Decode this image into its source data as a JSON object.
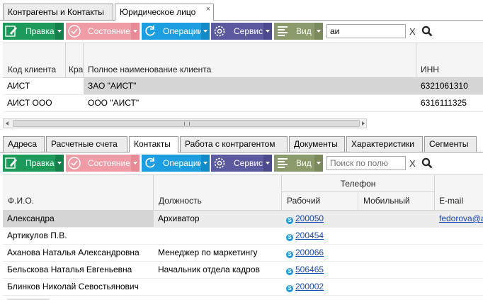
{
  "top_tabs": [
    {
      "label": "Контрагенты и Контакты"
    },
    {
      "label": "Юридическое лицо",
      "close": "×"
    }
  ],
  "toolbar1": {
    "edit": "Правка",
    "state": "Состояние",
    "ops": "Операции",
    "service": "Сервис",
    "view": "Вид",
    "search_value": "аи",
    "clear": "X"
  },
  "clients_table": {
    "headers": {
      "code": "Код клиента",
      "short": "Кра",
      "full": "Полное наименование клиента",
      "inn": "ИНН"
    },
    "rows": [
      {
        "code": "АИСТ",
        "full": "ЗАО \"АИСТ\"",
        "inn": "6321061310"
      },
      {
        "code": "АИСТ ООО",
        "full": "ООО \"АИСТ\"",
        "inn": "6316111325"
      }
    ]
  },
  "detail_tabs": [
    "Адреса",
    "Расчетные счета",
    "Контакты",
    "Работа с контрагентом",
    "Документы",
    "Характеристики",
    "Сегменты"
  ],
  "toolbar2": {
    "edit": "Правка",
    "state": "Состояние",
    "ops": "Операции",
    "service": "Сервис",
    "view": "Вид",
    "search_placeholder": "Поиск по полю",
    "clear": "X"
  },
  "contacts_table": {
    "headers": {
      "fio": "Ф.И.О.",
      "position": "Должность",
      "phone": "Телефон",
      "work": "Рабочий",
      "mobile": "Мобильный",
      "email": "E-mail"
    },
    "rows": [
      {
        "fio": "Александра",
        "position": "Архиватор",
        "work": "200050",
        "email": "fedorova@a"
      },
      {
        "fio": "Артикулов П.В.",
        "position": "",
        "work": "200454",
        "email": ""
      },
      {
        "fio": "Аханова Наталья Александровна",
        "position": "Менеджер по маркетингу",
        "work": "200066",
        "email": ""
      },
      {
        "fio": "Бельскова Наталья Евгеньевна",
        "position": "Начальник отдела кадров",
        "work": "506465",
        "email": ""
      },
      {
        "fio": "Блинков Николай Севостьянович",
        "position": "",
        "work": "200002",
        "email": ""
      }
    ]
  },
  "colors": {
    "green": "#1d9a5a",
    "pink": "#ef9ca6",
    "blue": "#1c9ee0",
    "purple": "#5c5a9e",
    "olive": "#8a9a6b",
    "selected_row": "#d6d6d6"
  },
  "icons": [
    "pencil-icon",
    "check-circle-icon",
    "refresh-icon",
    "gear-icon",
    "list-icon",
    "search-icon",
    "skype-icon",
    "close-icon"
  ]
}
